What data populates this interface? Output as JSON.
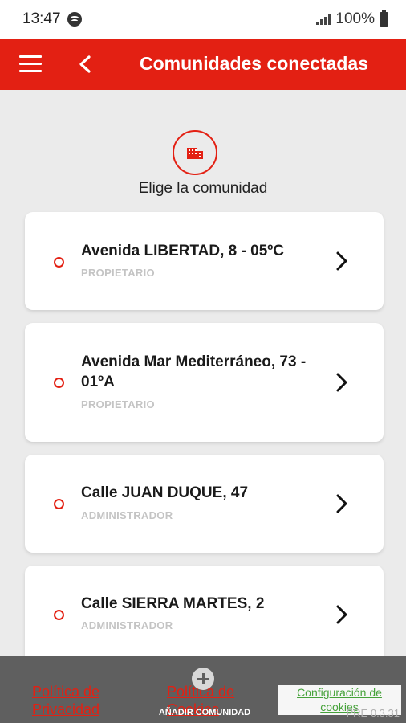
{
  "status_bar": {
    "time": "13:47",
    "battery": "100%"
  },
  "app_bar": {
    "title": "Comunidades conectadas"
  },
  "header": {
    "label": "Elige la comunidad"
  },
  "communities": [
    {
      "title": "Avenida LIBERTAD, 8 - 05ºC",
      "role": "PROPIETARIO"
    },
    {
      "title": "Avenida Mar Mediterráneo, 73 - 01ºA",
      "role": "PROPIETARIO"
    },
    {
      "title": "Calle JUAN DUQUE, 47",
      "role": "ADMINISTRADOR"
    },
    {
      "title": "Calle SIERRA MARTES, 2",
      "role": "ADMINISTRADOR"
    }
  ],
  "footer": {
    "privacy_link": "Política de Privacidad",
    "cookies_link": "Política de Cookies",
    "add_community": "AÑADIR COMUNIDAD",
    "cookie_config": "Configuración de cookies",
    "version": "PRE 0.3.31"
  },
  "colors": {
    "brand": "#e32013",
    "background": "#ebebeb",
    "bottom_bar": "#5f5f5f",
    "cookie_link": "#46a23a"
  },
  "icons": [
    "hamburger-icon",
    "back-icon",
    "building-icon",
    "chevron-right-icon",
    "add-circle-icon",
    "spotify-icon",
    "signal-icon",
    "battery-icon"
  ]
}
